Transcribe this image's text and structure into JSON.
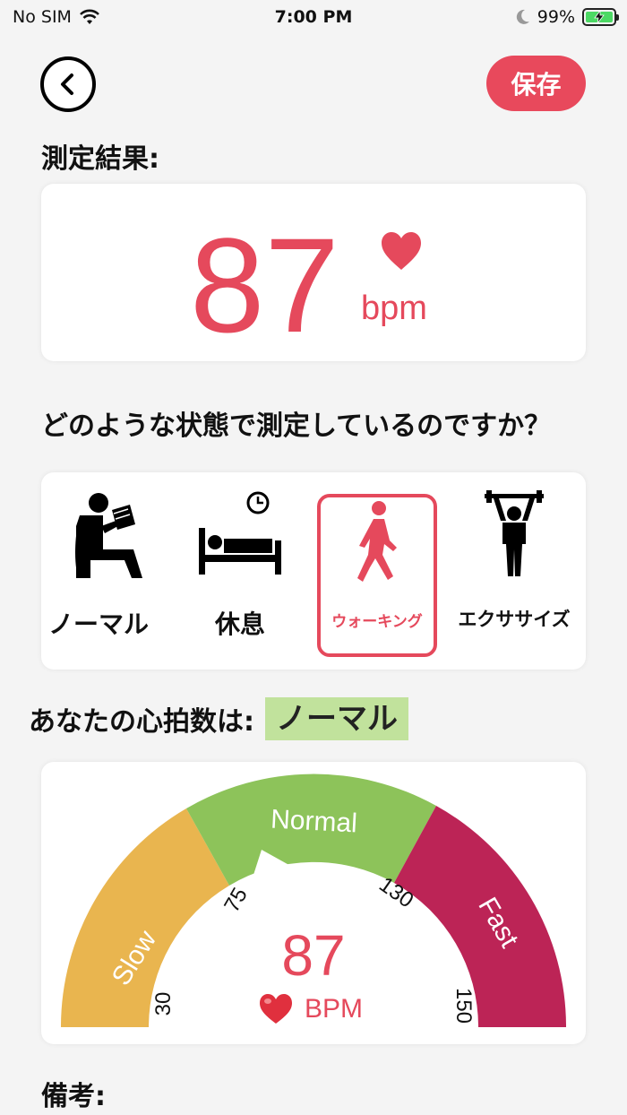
{
  "status_bar": {
    "carrier": "No SIM",
    "time": "7:00 PM",
    "battery": "99%"
  },
  "header": {
    "save_label": "保存"
  },
  "result": {
    "title": "測定結果:",
    "value": "87",
    "unit": "bpm"
  },
  "question": "どのような状態で測定しているのですか？",
  "activities": [
    {
      "label": "ノーマル",
      "icon": "reading-person-icon",
      "selected": false
    },
    {
      "label": "休息",
      "icon": "bed-sleep-icon",
      "selected": false
    },
    {
      "label": "ウォーキング",
      "icon": "walking-person-icon",
      "selected": true
    },
    {
      "label": "エクササイズ",
      "icon": "weightlifting-icon",
      "selected": false
    }
  ],
  "heart_rate_status": {
    "label": "あなたの心拍数は:",
    "value": "ノーマル"
  },
  "gauge": {
    "segments": [
      {
        "label": "Slow",
        "color": "#e9b54f"
      },
      {
        "label": "Normal",
        "color": "#8dc35a"
      },
      {
        "label": "Fast",
        "color": "#bc2456"
      }
    ],
    "ticks": [
      "30",
      "75",
      "130",
      "150"
    ],
    "value": "87",
    "unit": "BPM"
  },
  "notes": {
    "title": "備考:"
  },
  "colors": {
    "accent": "#e5495c",
    "badge_bg": "#c1e29c"
  }
}
